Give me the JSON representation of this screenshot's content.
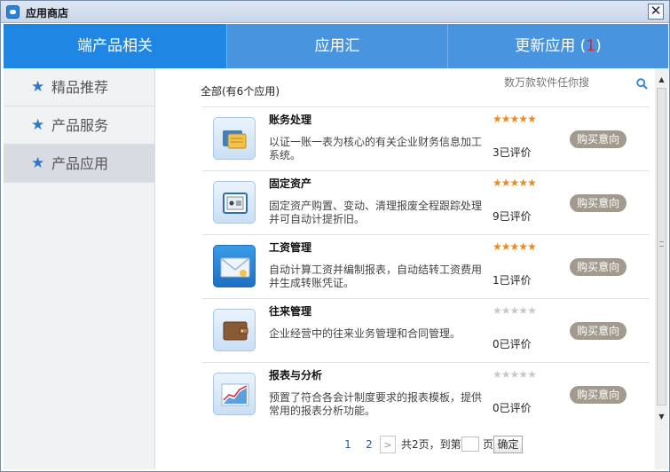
{
  "window": {
    "title": "应用商店",
    "close_label": "✕"
  },
  "tabs": [
    {
      "label": "端产品相关",
      "badge": ""
    },
    {
      "label": "应用汇",
      "badge": ""
    },
    {
      "label": "更新应用",
      "badge_open": "(",
      "badge": "1",
      "badge_close": ")"
    }
  ],
  "sidebar": {
    "items": [
      {
        "label": "精品推荐",
        "icon": "star-icon"
      },
      {
        "label": "产品服务",
        "icon": "star-icon"
      },
      {
        "label": "产品应用",
        "icon": "star-icon"
      }
    ],
    "active_index": 2
  },
  "main": {
    "all_label": "全部(有6个应用)",
    "search_placeholder": "数万款软件任你搜",
    "buy_label": "购买意向",
    "rated_suffix": "已评价",
    "apps": [
      {
        "name": "账务处理",
        "desc": "以证一账一表为核心的有关企业财务信息加工系统。",
        "rating": 5,
        "count": "3",
        "icon": "ledger-icon"
      },
      {
        "name": "固定资产",
        "desc": "固定资产购置、变动、清理报废全程跟踪处理并可自动计提折旧。",
        "rating": 5,
        "count": "9",
        "icon": "safe-icon"
      },
      {
        "name": "工资管理",
        "desc": "自动计算工资并编制报表，自动结转工资费用并生成转账凭证。",
        "rating": 5,
        "count": "1",
        "icon": "envelope-icon"
      },
      {
        "name": "往来管理",
        "desc": "企业经营中的往来业务管理和合同管理。",
        "rating": 0,
        "count": "0",
        "icon": "wallet-icon"
      },
      {
        "name": "报表与分析",
        "desc": "预置了符合各会计制度要求的报表模板，提供常用的报表分析功能。",
        "rating": 0,
        "count": "0",
        "icon": "chart-report-icon"
      }
    ]
  },
  "pagination": {
    "pages": [
      "1",
      "2"
    ],
    "next_label": ">",
    "total_text": "共2页，到第",
    "page_unit": "页",
    "confirm_label": "确定"
  },
  "colors": {
    "tab_active": "#1f86e3",
    "tab_inactive": "#4894df",
    "badge": "#e0203a",
    "star_on": "#f08a17",
    "star_off": "#c8c8c8",
    "buy_button": "#a39a8e"
  }
}
